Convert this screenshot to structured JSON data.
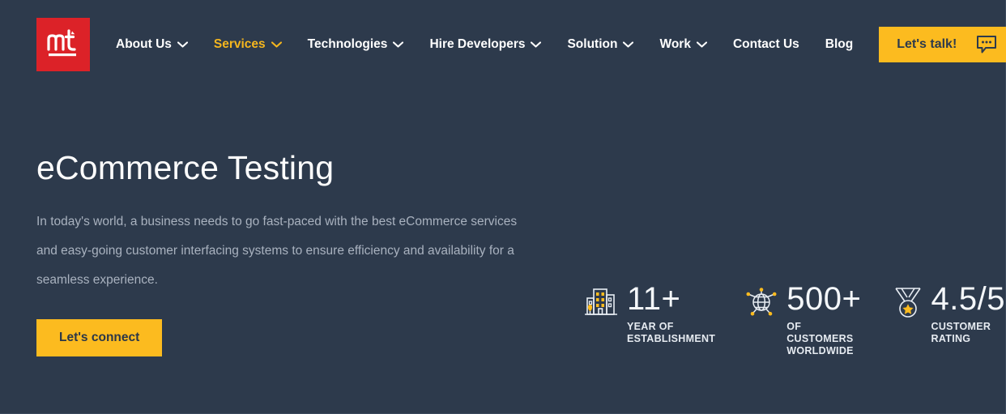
{
  "colors": {
    "background": "#2d3a4c",
    "accent_yellow": "#fcbb1f",
    "logo_red": "#dc2228",
    "text_primary": "#ffffff",
    "text_muted": "#a9b2bf"
  },
  "header": {
    "logo": {
      "text": "mt",
      "icon": "mt-logo-icon"
    },
    "nav": [
      {
        "label": "About Us",
        "has_caret": true,
        "active": false
      },
      {
        "label": "Services",
        "has_caret": true,
        "active": true
      },
      {
        "label": "Technologies",
        "has_caret": true,
        "active": false
      },
      {
        "label": "Hire Developers",
        "has_caret": true,
        "active": false
      },
      {
        "label": "Solution",
        "has_caret": true,
        "active": false
      },
      {
        "label": "Work",
        "has_caret": true,
        "active": false
      },
      {
        "label": "Contact Us",
        "has_caret": false,
        "active": false
      },
      {
        "label": "Blog",
        "has_caret": false,
        "active": false
      }
    ],
    "cta": {
      "label": "Let's talk!",
      "icon": "chat-bubble-icon"
    }
  },
  "hero": {
    "title": "eCommerce Testing",
    "description": "In today's world, a business needs to go fast-paced with the best eCommerce services and easy-going customer interfacing systems to ensure efficiency and availability for a seamless experience.",
    "cta_label": "Let's connect"
  },
  "stats": [
    {
      "icon": "building-icon",
      "value": "11+",
      "label": "YEAR OF\nESTABLISHMENT"
    },
    {
      "icon": "globe-network-icon",
      "value": "500+",
      "label": "OF CUSTOMERS\nWORLDWIDE"
    },
    {
      "icon": "medal-star-icon",
      "value": "4.5/5",
      "label": "CUSTOMER\nRATING"
    }
  ]
}
